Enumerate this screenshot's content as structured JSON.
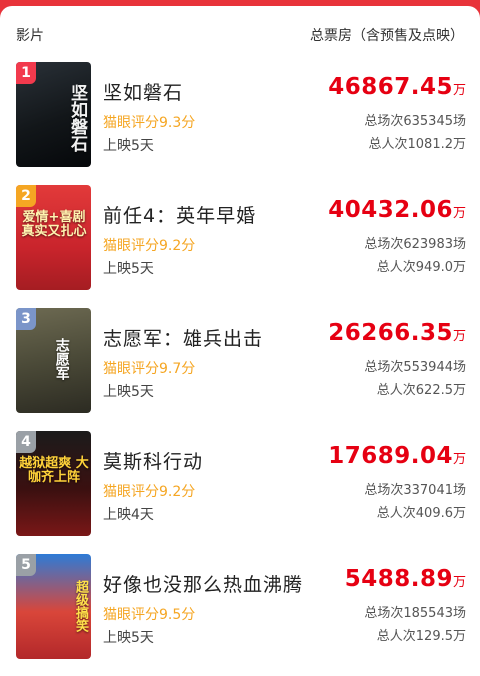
{
  "header": {
    "left": "影片",
    "right": "总票房（含预售及点映）"
  },
  "colors": {
    "accent": "#e60012",
    "score": "#f5a623",
    "background": "#e8333a"
  },
  "movies": [
    {
      "rank": "1",
      "title": "坚如磐石",
      "score": "猫眼评分9.3分",
      "days": "上映5天",
      "box": "46867.45",
      "unit": "万",
      "shows": "总场次635345场",
      "audience": "总人次1081.2万",
      "poster_text": "坚如磐石"
    },
    {
      "rank": "2",
      "title": "前任4：英年早婚",
      "score": "猫眼评分9.2分",
      "days": "上映5天",
      "box": "40432.06",
      "unit": "万",
      "shows": "总场次623983场",
      "audience": "总人次949.0万",
      "poster_text": "爱情+喜剧 真实又扎心"
    },
    {
      "rank": "3",
      "title": "志愿军：雄兵出击",
      "score": "猫眼评分9.7分",
      "days": "上映5天",
      "box": "26266.35",
      "unit": "万",
      "shows": "总场次553944场",
      "audience": "总人次622.5万",
      "poster_text": "志愿军"
    },
    {
      "rank": "4",
      "title": "莫斯科行动",
      "score": "猫眼评分9.2分",
      "days": "上映4天",
      "box": "17689.04",
      "unit": "万",
      "shows": "总场次337041场",
      "audience": "总人次409.6万",
      "poster_text": "越狱超爽 大咖齐上阵"
    },
    {
      "rank": "5",
      "title": "好像也没那么热血沸腾",
      "score": "猫眼评分9.5分",
      "days": "上映5天",
      "box": "5488.89",
      "unit": "万",
      "shows": "总场次185543场",
      "audience": "总人次129.5万",
      "poster_text": "超级搞笑"
    }
  ]
}
